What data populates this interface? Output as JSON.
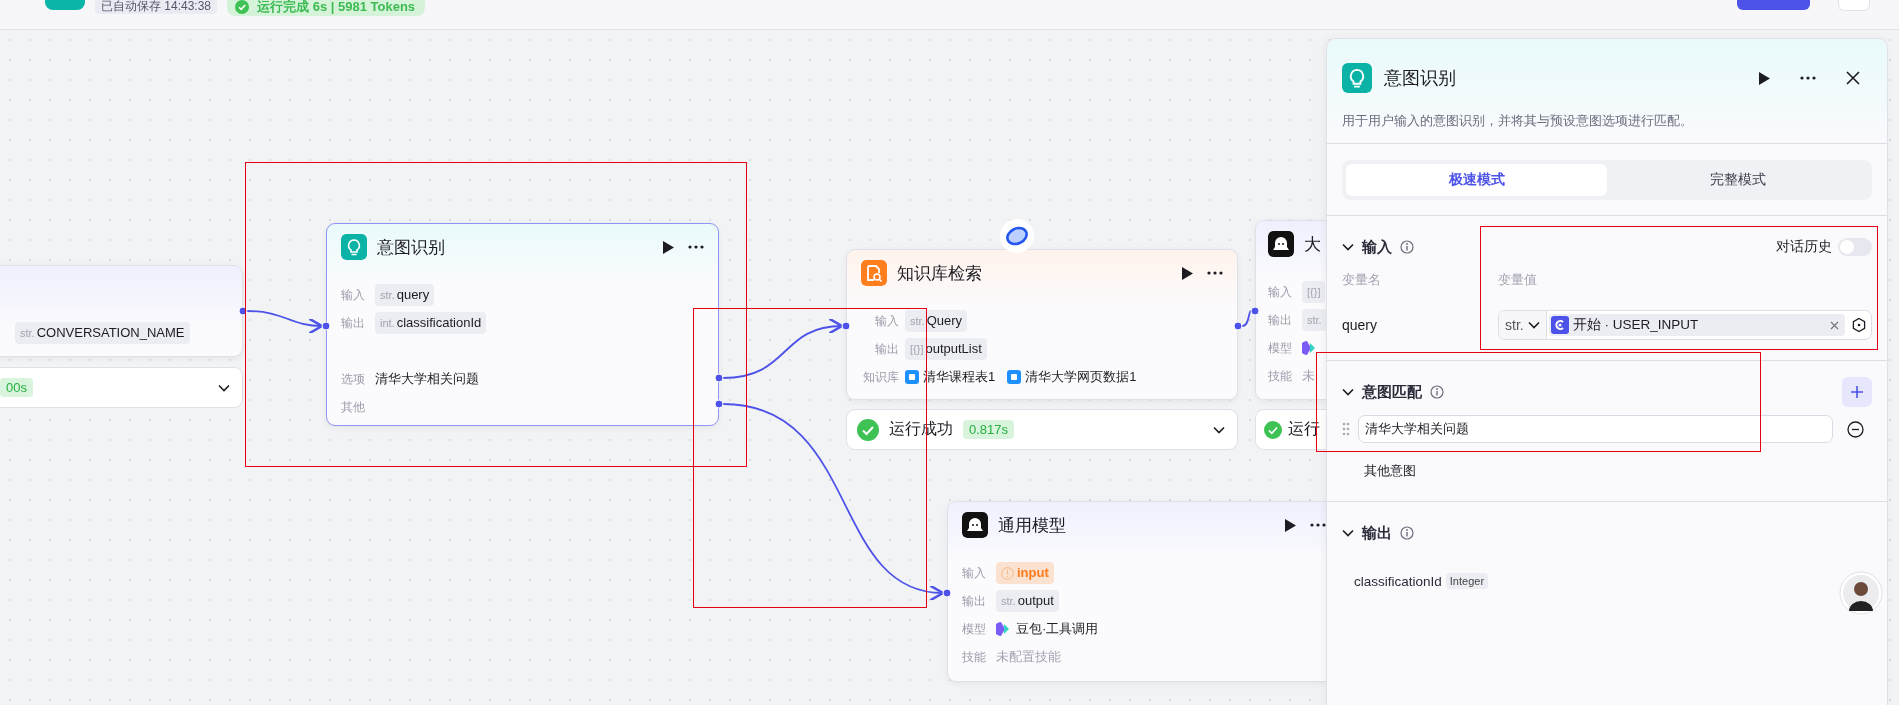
{
  "top_bar": {
    "autosave": "已自动保存 14:43:38",
    "run_status": "运行完成 6s | 5981 Tokens"
  },
  "nodes": [
    {
      "kind": "start",
      "rows": [
        {
          "kind": "var",
          "tag": "str.",
          "value": "CONVERSATION_NAME"
        }
      ],
      "status_time": "00s"
    },
    {
      "kind": "intent",
      "title": "意图识别",
      "rows": [
        {
          "kind": "var",
          "label": "输入",
          "tag": "str.",
          "value": "query"
        },
        {
          "kind": "var",
          "label": "输出",
          "tag": "int.",
          "value": "classificationId"
        },
        {
          "kind": "spacer"
        },
        {
          "kind": "option",
          "label": "选项",
          "value": "清华大学相关问题"
        },
        {
          "kind": "empty",
          "label": "其他"
        }
      ]
    },
    {
      "kind": "knowledge",
      "title": "知识库检索",
      "rows": [
        {
          "kind": "var",
          "label": "输入",
          "tag": "str.",
          "value": "Query"
        },
        {
          "kind": "var",
          "label": "输出",
          "tag": "[{}]",
          "value": "outputList"
        },
        {
          "kind": "kb",
          "label": "知识库",
          "items": [
            "清华课程表1",
            "清华大学网页数据1"
          ]
        }
      ],
      "status": "运行成功",
      "status_time": "0.817s"
    },
    {
      "kind": "llm",
      "title": "大",
      "rows": [
        {
          "kind": "tag",
          "label": "输入",
          "tag": "[{}]"
        },
        {
          "kind": "tag",
          "label": "输出",
          "tag": "str."
        },
        {
          "kind": "model",
          "label": "模型"
        },
        {
          "kind": "muted",
          "label": "技能",
          "value": "未"
        }
      ],
      "status": "运行"
    },
    {
      "kind": "llm",
      "title": "通用模型",
      "rows": [
        {
          "kind": "warning",
          "label": "输入",
          "value": "input"
        },
        {
          "kind": "var",
          "label": "输出",
          "tag": "str.",
          "value": "output"
        },
        {
          "kind": "model",
          "label": "模型",
          "value": "豆包·工具调用"
        },
        {
          "kind": "muted",
          "label": "技能",
          "value": "未配置技能"
        }
      ]
    }
  ],
  "panel": {
    "title": "意图识别",
    "description": "用于用户输入的意图识别，并将其与预设意图选项进行匹配。",
    "modes": [
      {
        "label": "极速模式",
        "selected": true
      },
      {
        "label": "完整模式",
        "selected": false
      }
    ],
    "input_section": {
      "title": "输入",
      "history_label": "对话历史",
      "history_on": false,
      "name_header": "变量名",
      "value_header": "变量值",
      "var_name": "query",
      "type": "str.",
      "source": "开始 · USER_INPUT"
    },
    "intent_section": {
      "title": "意图匹配",
      "intents": [
        "清华大学相关问题"
      ],
      "other": "其他意图"
    },
    "output_section": {
      "title": "输出",
      "var": "classificationId",
      "type": "Integer"
    }
  },
  "annotation_boxes": [
    {
      "color": "#e60012"
    },
    {
      "color": "#e60012"
    },
    {
      "color": "#e60012"
    },
    {
      "color": "#e60012"
    }
  ]
}
